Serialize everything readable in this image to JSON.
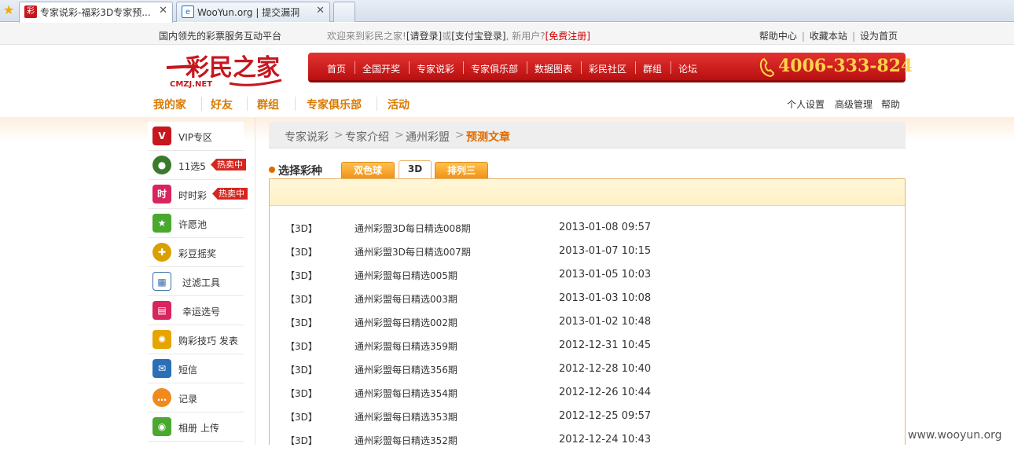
{
  "browser": {
    "tabs": [
      {
        "title": "专家说彩-福彩3D专家预...",
        "close": "✕"
      },
      {
        "title": "WooYun.org | 提交漏洞",
        "close": "✕"
      }
    ]
  },
  "topbar": {
    "slogan": "国内领先的彩票服务互动平台",
    "welcome": "欢迎来到彩民之家!",
    "login": "[请登录]",
    "or": "或",
    "alipay": "[支付宝登录]",
    "newuser": ", 新用户?",
    "register": "[免费注册]",
    "links": [
      "帮助中心",
      "收藏本站",
      "设为首页"
    ],
    "link_sep": "|"
  },
  "logo": {
    "main": "彩民之家",
    "sub": "CMZJ.NET"
  },
  "nav": {
    "items": [
      "首页",
      "全国开奖",
      "专家说彩",
      "专家俱乐部",
      "数据图表",
      "彩民社区",
      "群组",
      "论坛"
    ],
    "phone": "4006-333-824"
  },
  "subnav": {
    "left": [
      "我的家",
      "好友",
      "群组",
      "专家俱乐部",
      "活动"
    ],
    "right": [
      "个人设置",
      "高级管理",
      "帮助"
    ]
  },
  "sidebar": {
    "items": [
      {
        "label": "VIP专区",
        "icon": "vip-icon",
        "glyph": "V",
        "color": "#c8161d"
      },
      {
        "label": "11选5",
        "icon": "ball-icon",
        "glyph": "●",
        "color": "#3a7a2a",
        "badge": "热卖中"
      },
      {
        "label": "时时彩",
        "icon": "shi-icon",
        "glyph": "时",
        "color": "#d9245e",
        "badge": "热卖中"
      },
      {
        "label": "许愿池",
        "icon": "star-icon",
        "glyph": "★",
        "color": "#4aa82e"
      },
      {
        "label": "彩豆摇奖",
        "icon": "bean-icon",
        "glyph": "✚",
        "color": "#d8a000"
      },
      {
        "label": "过滤工具",
        "icon": "filter-icon",
        "glyph": "▦",
        "color": "#3a6ea8"
      },
      {
        "label": "幸运选号",
        "icon": "lucky-icon",
        "glyph": "▤",
        "color": "#d9245e"
      },
      {
        "label": "购彩技巧 发表",
        "icon": "gear-icon",
        "glyph": "✺",
        "color": "#e6a400"
      },
      {
        "label": "短信",
        "icon": "mail-icon",
        "glyph": "✉",
        "color": "#2b6fb6"
      },
      {
        "label": "记录",
        "icon": "chat-icon",
        "glyph": "…",
        "color": "#f08a1c"
      },
      {
        "label": "相册 上传",
        "icon": "photo-icon",
        "glyph": "◉",
        "color": "#4aa82e"
      }
    ]
  },
  "breadcrumb": {
    "items": [
      "专家说彩",
      "专家介绍",
      "通州彩盟"
    ],
    "current": "预测文章",
    "sep": ">"
  },
  "selector": {
    "label": "选择彩种",
    "tabs": [
      "双色球",
      "3D",
      "排列三"
    ],
    "active": 1
  },
  "articles": [
    {
      "cat": "【3D】",
      "title": "通州彩盟3D每日精选008期",
      "date": "2013-01-08 09:57"
    },
    {
      "cat": "【3D】",
      "title": "通州彩盟3D每日精选007期",
      "date": "2013-01-07 10:15"
    },
    {
      "cat": "【3D】",
      "title": "通州彩盟每日精选005期",
      "date": "2013-01-05 10:03"
    },
    {
      "cat": "【3D】",
      "title": "通州彩盟每日精选003期",
      "date": "2013-01-03 10:08"
    },
    {
      "cat": "【3D】",
      "title": "通州彩盟每日精选002期",
      "date": "2013-01-02 10:48"
    },
    {
      "cat": "【3D】",
      "title": "通州彩盟每日精选359期",
      "date": "2012-12-31 10:45"
    },
    {
      "cat": "【3D】",
      "title": "通州彩盟每日精选356期",
      "date": "2012-12-28 10:40"
    },
    {
      "cat": "【3D】",
      "title": "通州彩盟每日精选354期",
      "date": "2012-12-26 10:44"
    },
    {
      "cat": "【3D】",
      "title": "通州彩盟每日精选353期",
      "date": "2012-12-25 09:57"
    },
    {
      "cat": "【3D】",
      "title": "通州彩盟每日精选352期",
      "date": "2012-12-24 10:43"
    }
  ],
  "watermark": "www.wooyun.org",
  "colors": {
    "brand_red": "#c8161d",
    "accent_orange": "#e06b00",
    "phone_gold": "#ffd34a"
  }
}
